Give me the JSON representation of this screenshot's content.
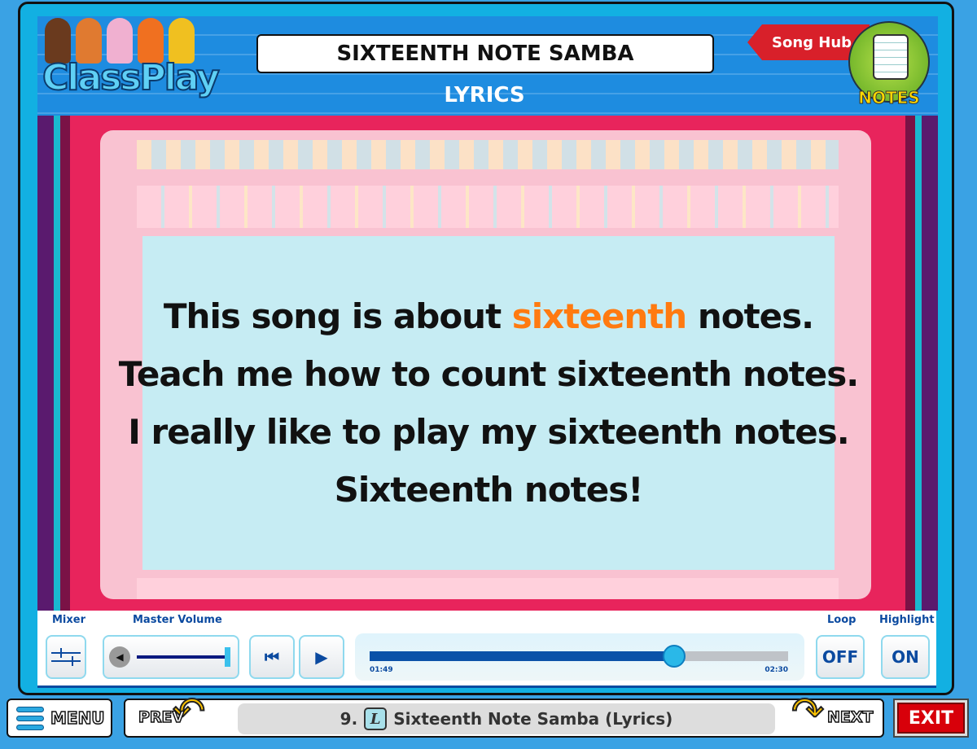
{
  "header": {
    "logo": "ClassPlay",
    "title": "SIXTEENTH NOTE SAMBA",
    "subtitle": "LYRICS",
    "song_hub": "Song Hub",
    "notes": "NOTES"
  },
  "lyrics": {
    "line1_pre": "This song is about ",
    "line1_hl": "sixteenth",
    "line1_post": " notes.",
    "line2": "Teach me how to count sixteenth notes.",
    "line3": "I really like to play my sixteenth notes.",
    "line4": "Sixteenth notes!",
    "highlight_color": "#ff7a10"
  },
  "controls": {
    "mixer_label": "Mixer",
    "volume_label": "Master Volume",
    "volume_level": 1.0,
    "elapsed": "01:49",
    "total": "02:30",
    "progress": 0.727,
    "loop_label": "Loop",
    "loop_value": "OFF",
    "highlight_label": "Highlight",
    "highlight_value": "ON"
  },
  "nav": {
    "menu": "MENU",
    "prev": "PREV",
    "next": "NEXT",
    "exit": "EXIT",
    "track_number": "9.",
    "track_icon": "L",
    "track_title": "Sixteenth Note Samba (Lyrics)"
  }
}
